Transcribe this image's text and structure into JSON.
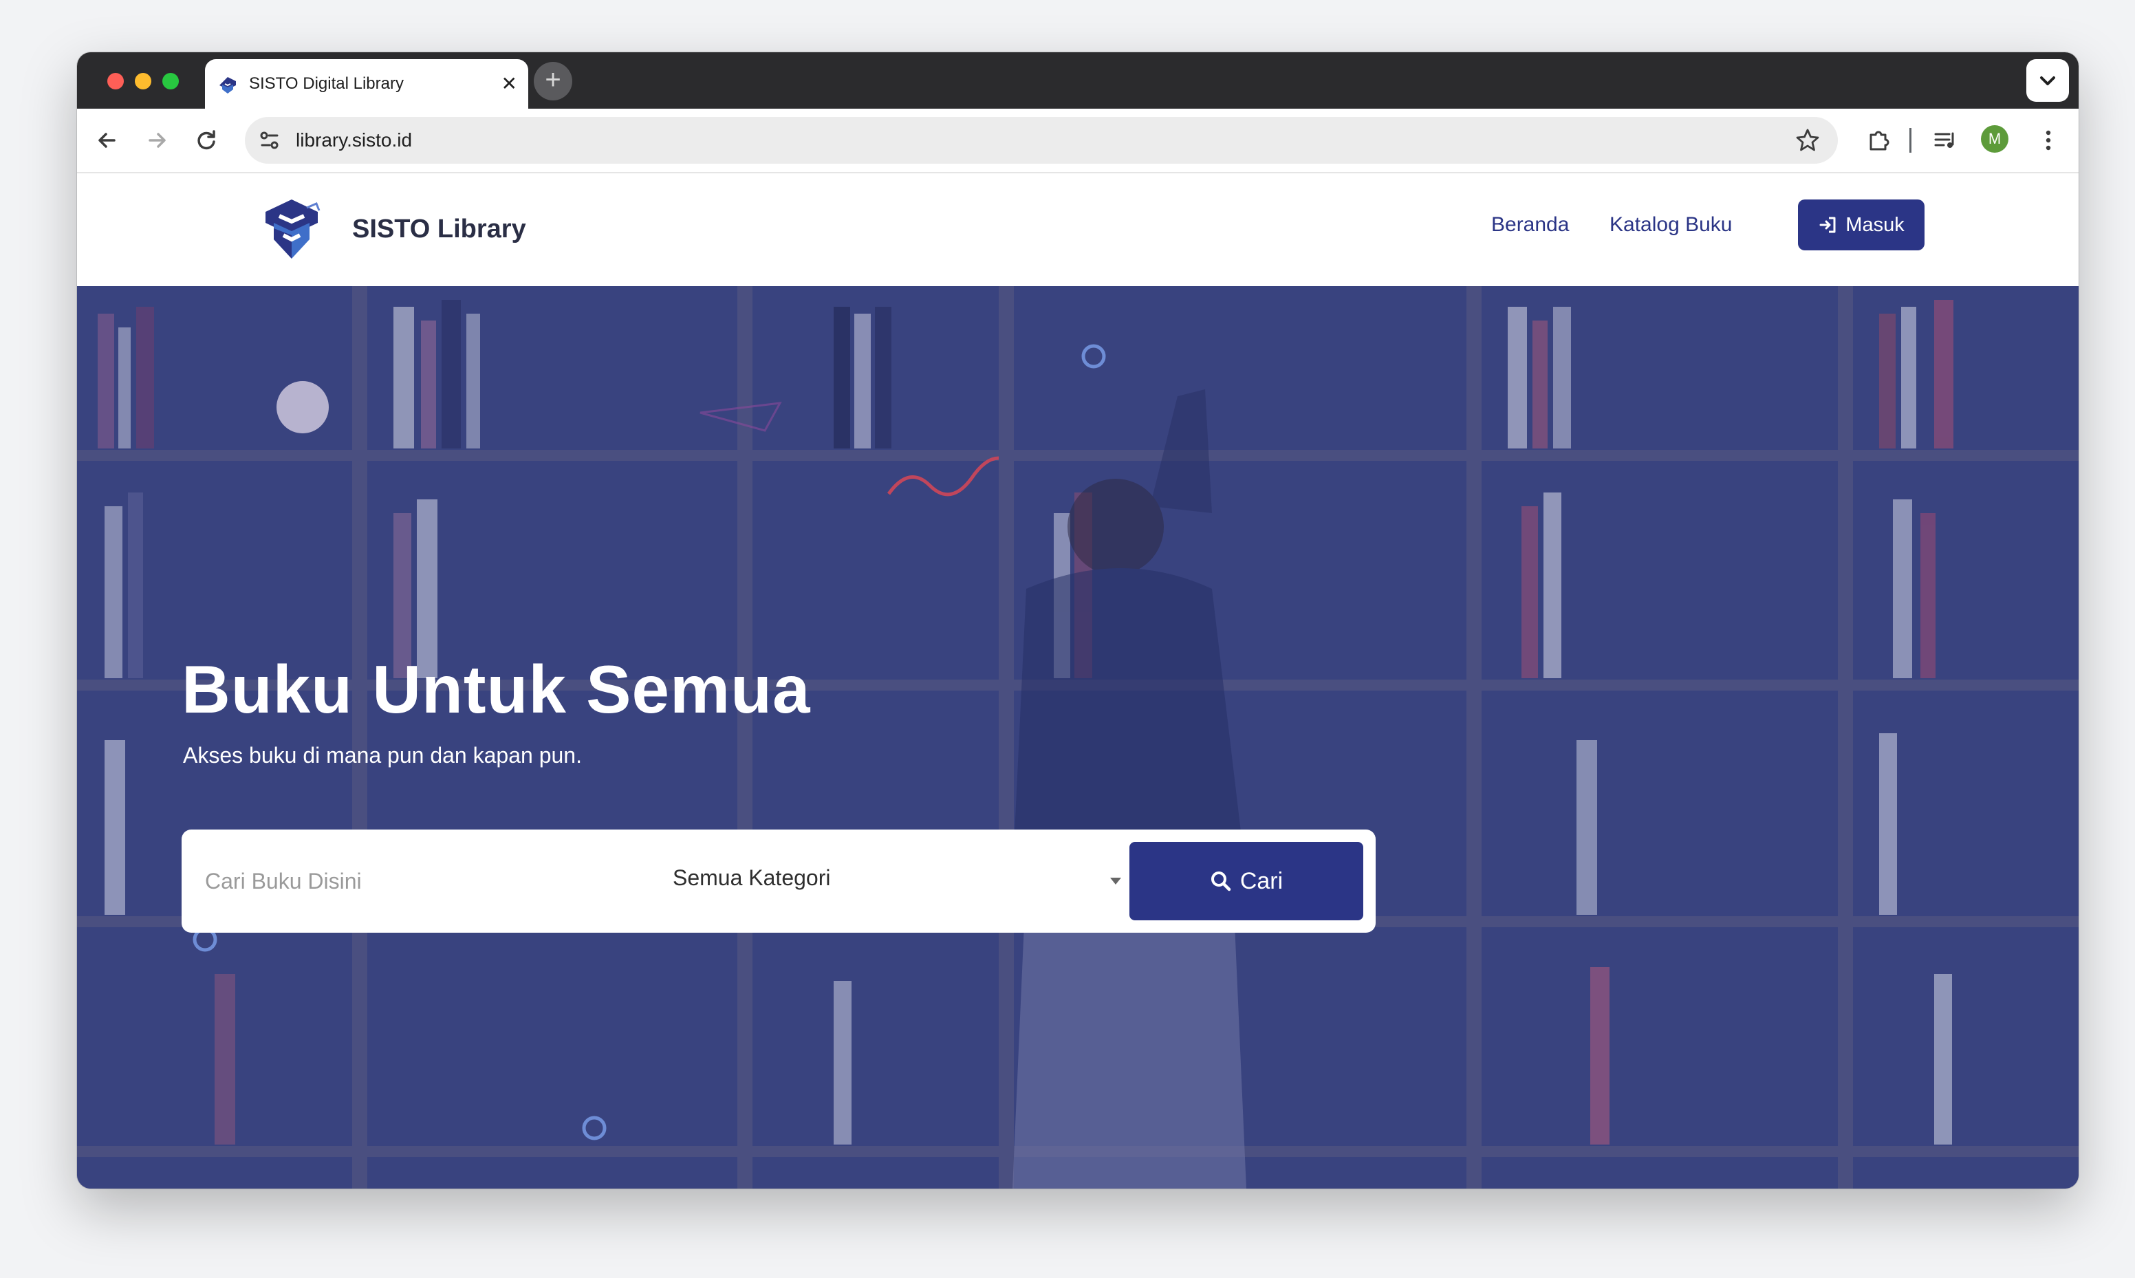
{
  "browser": {
    "tab_title": "SISTO Digital Library",
    "tab_close": "✕",
    "new_tab": "+",
    "url": "library.sisto.id",
    "profile_initial": "M"
  },
  "site": {
    "brand": "SISTO Library",
    "nav": [
      {
        "label": "Beranda"
      },
      {
        "label": "Katalog Buku"
      }
    ],
    "login_label": "Masuk"
  },
  "hero": {
    "title": "Buku Untuk Semua",
    "subtitle": "Akses buku di mana pun dan kapan pun.",
    "search_placeholder": "Cari Buku Disini",
    "category_selected": "Semua Kategori",
    "search_button": "Cari"
  },
  "colors": {
    "primary": "#2b3586",
    "hero_overlay": "#3a4590"
  }
}
